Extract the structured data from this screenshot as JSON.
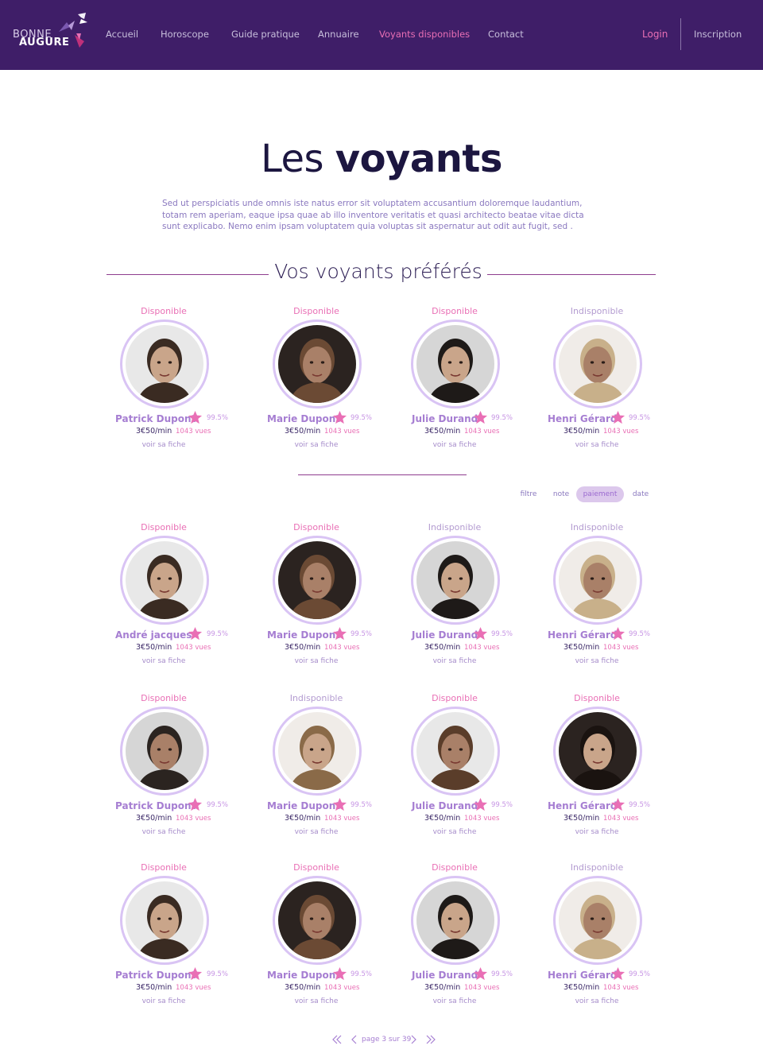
{
  "brand": {
    "line1": "BONNE",
    "line2": "AUGURE"
  },
  "nav": [
    {
      "label": "Accueil",
      "active": false
    },
    {
      "label": "Horoscope",
      "active": false
    },
    {
      "label": "Guide pratique",
      "active": false
    },
    {
      "label": "Annuaire",
      "active": false
    },
    {
      "label": "Voyants disponibles",
      "active": true
    },
    {
      "label": "Contact",
      "active": false
    }
  ],
  "auth": {
    "login": "Login",
    "signup": "Inscription"
  },
  "title": {
    "light": "Les ",
    "bold": "voyants"
  },
  "intro": "Sed ut perspiciatis unde omnis iste natus error sit voluptatem accusantium doloremque laudantium, totam rem aperiam, eaque ipsa quae ab illo inventore veritatis et quasi architecto beatae vitae dicta sunt explicabo. Nemo enim ipsam voluptatem quia voluptas sit aspernatur aut odit aut fugit, sed .",
  "favorites_title": "Vos voyants préférés",
  "filters": [
    {
      "label": "filtre",
      "active": false
    },
    {
      "label": "note",
      "active": false
    },
    {
      "label": "paiement",
      "active": true
    },
    {
      "label": "date",
      "active": false
    }
  ],
  "colors": {
    "header": "#3f1e68",
    "accent": "#e96fb5",
    "ring": "#d9c4f4",
    "name": "#a67ed2"
  },
  "favorites": [
    {
      "status": "Disponible",
      "available": true,
      "name": "Patrick Dupont",
      "rating": "99.5%",
      "price": "3€50/min",
      "views": "1043 vues",
      "link": "voir sa fiche"
    },
    {
      "status": "Disponible",
      "available": true,
      "name": "Marie Dupont",
      "rating": "99.5%",
      "price": "3€50/min",
      "views": "1043 vues",
      "link": "voir sa fiche"
    },
    {
      "status": "Disponible",
      "available": true,
      "name": "Julie Durand",
      "rating": "99.5%",
      "price": "3€50/min",
      "views": "1043 vues",
      "link": "voir sa fiche"
    },
    {
      "status": "Indisponible",
      "available": false,
      "name": "Henri Gérard",
      "rating": "99.5%",
      "price": "3€50/min",
      "views": "1043 vues",
      "link": "voir sa fiche"
    }
  ],
  "seers": [
    {
      "status": "Disponible",
      "available": true,
      "name": "André jacques",
      "rating": "99.5%",
      "price": "3€50/min",
      "views": "1043 vues",
      "link": "voir sa fiche"
    },
    {
      "status": "Disponible",
      "available": true,
      "name": "Marie Dupont",
      "rating": "99.5%",
      "price": "3€50/min",
      "views": "1043 vues",
      "link": "voir sa fiche"
    },
    {
      "status": "Indisponible",
      "available": false,
      "name": "Julie Durand",
      "rating": "99.5%",
      "price": "3€50/min",
      "views": "1043 vues",
      "link": "voir sa fiche"
    },
    {
      "status": "Indisponible",
      "available": false,
      "name": "Henri Gérard",
      "rating": "99.5%",
      "price": "3€50/min",
      "views": "1043 vues",
      "link": "voir sa fiche"
    },
    {
      "status": "Disponible",
      "available": true,
      "name": "Patrick Dupont",
      "rating": "99.5%",
      "price": "3€50/min",
      "views": "1043 vues",
      "link": "voir sa fiche"
    },
    {
      "status": "Indisponible",
      "available": false,
      "name": "Marie Dupont",
      "rating": "99.5%",
      "price": "3€50/min",
      "views": "1043 vues",
      "link": "voir sa fiche"
    },
    {
      "status": "Disponible",
      "available": true,
      "name": "Julie Durand",
      "rating": "99.5%",
      "price": "3€50/min",
      "views": "1043 vues",
      "link": "voir sa fiche"
    },
    {
      "status": "Disponible",
      "available": true,
      "name": "Henri Gérard",
      "rating": "99.5%",
      "price": "3€50/min",
      "views": "1043 vues",
      "link": "voir sa fiche"
    },
    {
      "status": "Disponible",
      "available": true,
      "name": "Patrick Dupont",
      "rating": "99.5%",
      "price": "3€50/min",
      "views": "1043 vues",
      "link": "voir sa fiche"
    },
    {
      "status": "Disponible",
      "available": true,
      "name": "Marie Dupont",
      "rating": "99.5%",
      "price": "3€50/min",
      "views": "1043 vues",
      "link": "voir sa fiche"
    },
    {
      "status": "Disponible",
      "available": true,
      "name": "Julie Durand",
      "rating": "99.5%",
      "price": "3€50/min",
      "views": "1043 vues",
      "link": "voir sa fiche"
    },
    {
      "status": "Indisponible",
      "available": false,
      "name": "Henri Gérard",
      "rating": "99.5%",
      "price": "3€50/min",
      "views": "1043 vues",
      "link": "voir sa fiche"
    }
  ],
  "pagination": {
    "text": "page 3 sur 39",
    "first_icon": "double-chevron-left-icon",
    "prev_icon": "chevron-left-icon",
    "next_icon": "chevron-right-icon",
    "last_icon": "double-chevron-right-icon"
  }
}
